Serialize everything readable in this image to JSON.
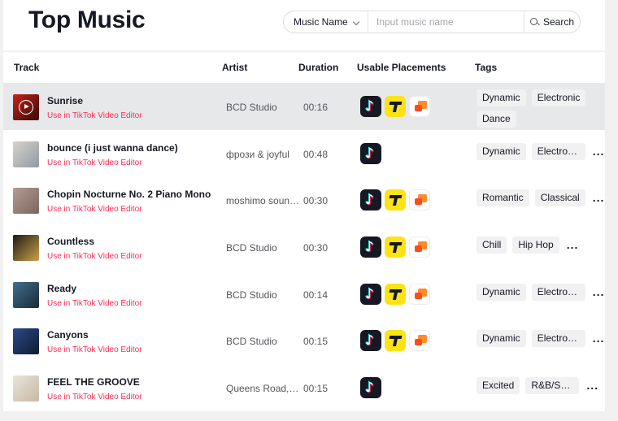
{
  "header": {
    "title": "Top Music",
    "search": {
      "select_label": "Music Name",
      "placeholder": "Input music name",
      "value": "",
      "button_label": "Search"
    }
  },
  "table": {
    "columns": [
      "Track",
      "Artist",
      "Duration",
      "Usable Placements",
      "Tags"
    ],
    "rows": [
      {
        "title": "Sunrise",
        "link": "Use in TikTok Video Editor",
        "artist": "BCD Studio",
        "duration": "00:16",
        "placements": [
          "tiktok",
          "topbuzz",
          "capcut"
        ],
        "tags": [
          "Dynamic",
          "Electronic",
          "Dance"
        ],
        "more": ""
      },
      {
        "title": "bounce (i just wanna dance)",
        "link": "Use in TikTok Video Editor",
        "artist": "фрози & joyful",
        "duration": "00:48",
        "placements": [
          "tiktok"
        ],
        "tags": [
          "Dynamic",
          "Electronic"
        ],
        "more": "..."
      },
      {
        "title": "Chopin Nocturne No. 2 Piano Mono",
        "link": "Use in TikTok Video Editor",
        "artist": "moshimo sound design",
        "duration": "00:30",
        "placements": [
          "tiktok",
          "topbuzz",
          "capcut"
        ],
        "tags": [
          "Romantic",
          "Classical"
        ],
        "more": "..."
      },
      {
        "title": "Countless",
        "link": "Use in TikTok Video Editor",
        "artist": "BCD Studio",
        "duration": "00:30",
        "placements": [
          "tiktok",
          "topbuzz",
          "capcut"
        ],
        "tags": [
          "Chill",
          "Hip Hop"
        ],
        "more": "..."
      },
      {
        "title": "Ready",
        "link": "Use in TikTok Video Editor",
        "artist": "BCD Studio",
        "duration": "00:14",
        "placements": [
          "tiktok",
          "topbuzz",
          "capcut"
        ],
        "tags": [
          "Dynamic",
          "Electronic"
        ],
        "more": "..."
      },
      {
        "title": "Canyons",
        "link": "Use in TikTok Video Editor",
        "artist": "BCD Studio",
        "duration": "00:15",
        "placements": [
          "tiktok",
          "topbuzz",
          "capcut"
        ],
        "tags": [
          "Dynamic",
          "Electronic"
        ],
        "more": "..."
      },
      {
        "title": "FEEL THE GROOVE",
        "link": "Use in TikTok Video Editor",
        "artist": "Queens Road, Fresh",
        "duration": "00:15",
        "placements": [
          "tiktok"
        ],
        "tags": [
          "Excited",
          "R&B/Soul"
        ],
        "more": "..."
      }
    ]
  },
  "icons": {
    "tiktok": "tiktok-icon",
    "topbuzz": "topbuzz-icon",
    "capcut": "pangle-icon",
    "search": "search-icon",
    "chevron": "chevron-down-icon"
  },
  "colors": {
    "accent_link": "#fe2c55",
    "row_highlight": "#e7e8ea",
    "topbuzz": "#fbe317",
    "tiktok": "#161823"
  },
  "thumb_colors": [
    [
      "#c2241a",
      "#3a0808"
    ],
    [
      "#d9d3c9",
      "#8e9aa8"
    ],
    [
      "#b49c92",
      "#7a665e"
    ],
    [
      "#1e1a12",
      "#c9a24a"
    ],
    [
      "#3f6f8f",
      "#1c2a33"
    ],
    [
      "#2a4a86",
      "#101a33"
    ],
    [
      "#e9e4da",
      "#c7b9a6"
    ]
  ]
}
